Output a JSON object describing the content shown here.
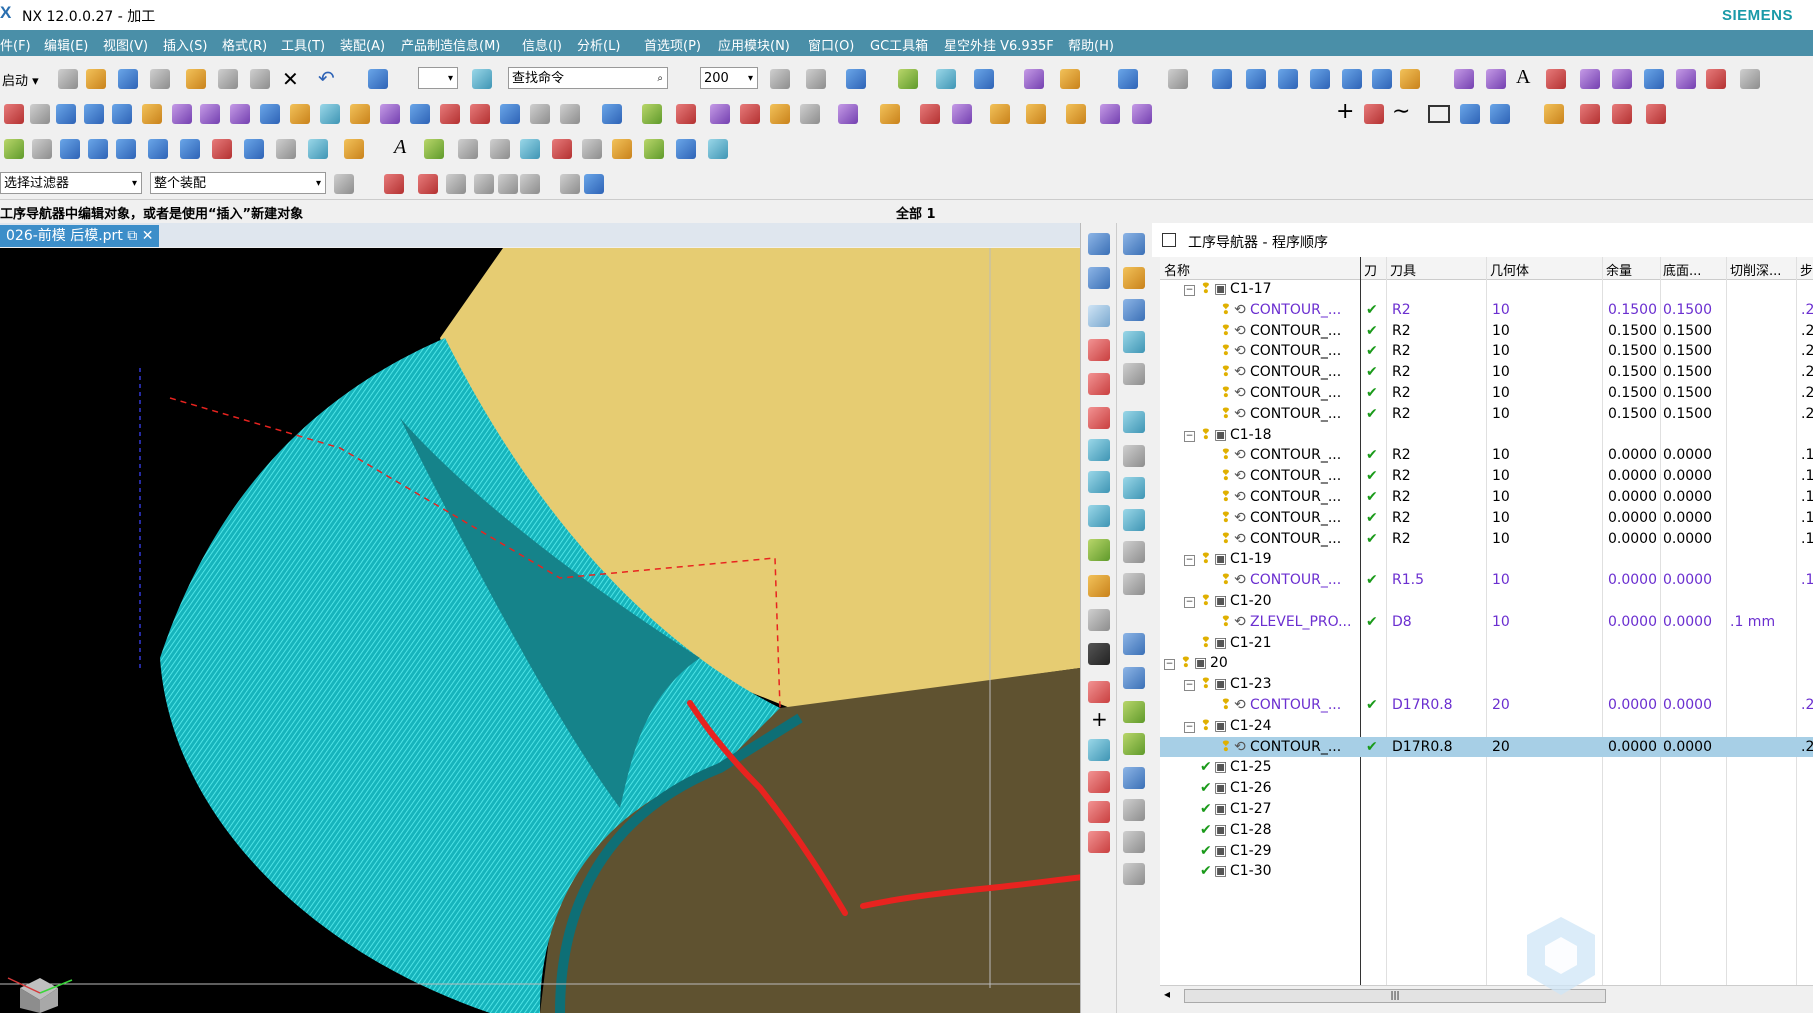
{
  "window": {
    "logo": "X",
    "title": "NX 12.0.0.27 - 加工",
    "brand": "SIEMENS"
  },
  "menu": [
    "件(F)",
    "编辑(E)",
    "视图(V)",
    "插入(S)",
    "格式(R)",
    "工具(T)",
    "装配(A)",
    "产品制造信息(M)",
    "信息(I)",
    "分析(L)",
    "首选项(P)",
    "应用模块(N)",
    "窗口(O)",
    "GC工具箱",
    "星空外挂 V6.935F",
    "帮助(H)"
  ],
  "toolbar": {
    "start_label": "启动",
    "search_placeholder": "查找命令",
    "zoom_value": "200",
    "filter_value": "选择过滤器",
    "assembly_value": "整个装配"
  },
  "status": {
    "message": "工序导航器中编辑对象，或者是使用“插入”新建对象",
    "selection": "全部 1"
  },
  "tab": {
    "label": "026-前模 后模.prt"
  },
  "navigator": {
    "title": "工序导航器 - 程序顺序",
    "columns": [
      "名称",
      "刀",
      "刀具",
      "几何体",
      "余量",
      "底面...",
      "切削深...",
      "步"
    ],
    "rows": [
      {
        "name": "C1-17",
        "type": "group",
        "level": 1,
        "tool": "",
        "geom": "",
        "stock": "",
        "floor": "",
        "depth": ""
      },
      {
        "name": "CONTOUR_...",
        "type": "op",
        "level": 2,
        "tool": "R2",
        "geom": "10",
        "stock": "0.1500",
        "floor": "0.1500",
        "depth": ".2",
        "purple": true
      },
      {
        "name": "CONTOUR_...",
        "type": "op",
        "level": 2,
        "tool": "R2",
        "geom": "10",
        "stock": "0.1500",
        "floor": "0.1500",
        "depth": ".2"
      },
      {
        "name": "CONTOUR_...",
        "type": "op",
        "level": 2,
        "tool": "R2",
        "geom": "10",
        "stock": "0.1500",
        "floor": "0.1500",
        "depth": ".2"
      },
      {
        "name": "CONTOUR_...",
        "type": "op",
        "level": 2,
        "tool": "R2",
        "geom": "10",
        "stock": "0.1500",
        "floor": "0.1500",
        "depth": ".2"
      },
      {
        "name": "CONTOUR_...",
        "type": "op",
        "level": 2,
        "tool": "R2",
        "geom": "10",
        "stock": "0.1500",
        "floor": "0.1500",
        "depth": ".2"
      },
      {
        "name": "CONTOUR_...",
        "type": "op",
        "level": 2,
        "tool": "R2",
        "geom": "10",
        "stock": "0.1500",
        "floor": "0.1500",
        "depth": ".2"
      },
      {
        "name": "C1-18",
        "type": "group",
        "level": 1,
        "tool": "",
        "geom": "",
        "stock": "",
        "floor": "",
        "depth": ""
      },
      {
        "name": "CONTOUR_...",
        "type": "op",
        "level": 2,
        "tool": "R2",
        "geom": "10",
        "stock": "0.0000",
        "floor": "0.0000",
        "depth": ".1"
      },
      {
        "name": "CONTOUR_...",
        "type": "op",
        "level": 2,
        "tool": "R2",
        "geom": "10",
        "stock": "0.0000",
        "floor": "0.0000",
        "depth": ".1"
      },
      {
        "name": "CONTOUR_...",
        "type": "op",
        "level": 2,
        "tool": "R2",
        "geom": "10",
        "stock": "0.0000",
        "floor": "0.0000",
        "depth": ".1"
      },
      {
        "name": "CONTOUR_...",
        "type": "op",
        "level": 2,
        "tool": "R2",
        "geom": "10",
        "stock": "0.0000",
        "floor": "0.0000",
        "depth": ".1"
      },
      {
        "name": "CONTOUR_...",
        "type": "op",
        "level": 2,
        "tool": "R2",
        "geom": "10",
        "stock": "0.0000",
        "floor": "0.0000",
        "depth": ".1"
      },
      {
        "name": "C1-19",
        "type": "group",
        "level": 1,
        "tool": "",
        "geom": "",
        "stock": "",
        "floor": "",
        "depth": ""
      },
      {
        "name": "CONTOUR_...",
        "type": "op",
        "level": 2,
        "tool": "R1.5",
        "geom": "10",
        "stock": "0.0000",
        "floor": "0.0000",
        "depth": ".1",
        "purple": true
      },
      {
        "name": "C1-20",
        "type": "group",
        "level": 1,
        "tool": "",
        "geom": "",
        "stock": "",
        "floor": "",
        "depth": ""
      },
      {
        "name": "ZLEVEL_PRO...",
        "type": "op",
        "level": 2,
        "tool": "D8",
        "geom": "10",
        "stock": "0.0000",
        "floor": "0.0000",
        "depth": ".1 mm",
        "purple": true
      },
      {
        "name": "C1-21",
        "type": "group-leaf",
        "level": 1,
        "tool": "",
        "geom": "",
        "stock": "",
        "floor": "",
        "depth": ""
      },
      {
        "name": "20",
        "type": "root",
        "level": 0,
        "tool": "",
        "geom": "",
        "stock": "",
        "floor": "",
        "depth": ""
      },
      {
        "name": "C1-23",
        "type": "group",
        "level": 1,
        "tool": "",
        "geom": "",
        "stock": "",
        "floor": "",
        "depth": ""
      },
      {
        "name": "CONTOUR_...",
        "type": "op",
        "level": 2,
        "tool": "D17R0.8",
        "geom": "20",
        "stock": "0.0000",
        "floor": "0.0000",
        "depth": ".2",
        "purple": true
      },
      {
        "name": "C1-24",
        "type": "group",
        "level": 1,
        "tool": "",
        "geom": "",
        "stock": "",
        "floor": "",
        "depth": ""
      },
      {
        "name": "CONTOUR_...",
        "type": "op",
        "level": 2,
        "tool": "D17R0.8",
        "geom": "20",
        "stock": "0.0000",
        "floor": "0.0000",
        "depth": ".2",
        "selected": true
      },
      {
        "name": "C1-25",
        "type": "done",
        "level": 1,
        "tool": "",
        "geom": "",
        "stock": "",
        "floor": "",
        "depth": ""
      },
      {
        "name": "C1-26",
        "type": "done",
        "level": 1,
        "tool": "",
        "geom": "",
        "stock": "",
        "floor": "",
        "depth": ""
      },
      {
        "name": "C1-27",
        "type": "done",
        "level": 1,
        "tool": "",
        "geom": "",
        "stock": "",
        "floor": "",
        "depth": ""
      },
      {
        "name": "C1-28",
        "type": "done",
        "level": 1,
        "tool": "",
        "geom": "",
        "stock": "",
        "floor": "",
        "depth": ""
      },
      {
        "name": "C1-29",
        "type": "done",
        "level": 1,
        "tool": "",
        "geom": "",
        "stock": "",
        "floor": "",
        "depth": ""
      },
      {
        "name": "C1-30",
        "type": "done",
        "level": 1,
        "tool": "",
        "geom": "",
        "stock": "",
        "floor": "",
        "depth": ""
      }
    ]
  },
  "colors": {
    "menubar": "#4a8fa8",
    "toolpath": "#1fe0e0",
    "part_face": "#e6cc72",
    "part_dark": "#5f5230",
    "annotation": "#e8231f",
    "selected_row": "#a7cfe6"
  }
}
